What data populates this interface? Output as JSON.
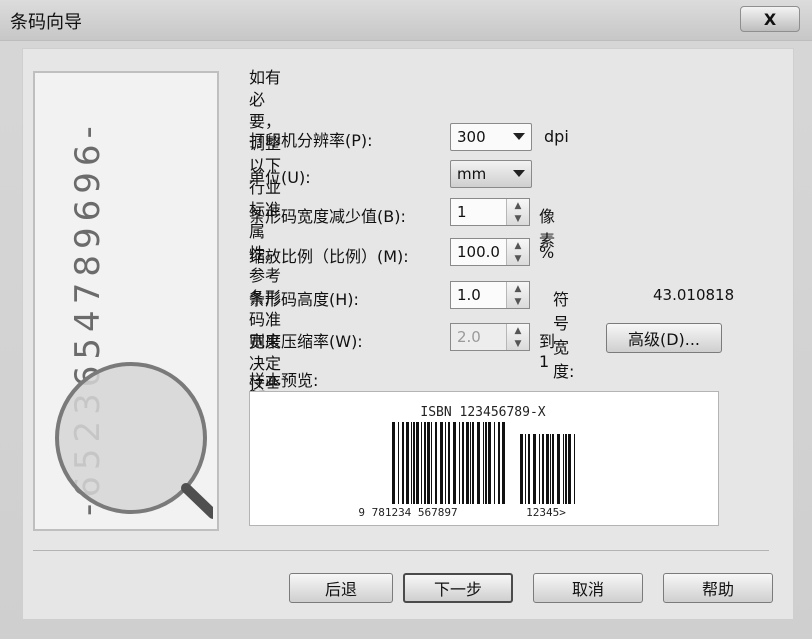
{
  "window": {
    "title": "条码向导",
    "close_label": "X"
  },
  "left_preview": {
    "digits": "-6523654789696-"
  },
  "intro": {
    "line1": "如有必要，调整以下行业标准属性。",
    "line2": "参考条形码准则来决定这些值。"
  },
  "fields": {
    "printer_resolution": {
      "label": "打印机分辨率(P):",
      "value": "300",
      "unit": "dpi"
    },
    "unit": {
      "label": "单位(U):",
      "value": "mm"
    },
    "bar_width_reduction": {
      "label": "条形码宽度减少值(B):",
      "value": "1",
      "unit": "像素"
    },
    "scale": {
      "label": "缩放比例（比例）(M):",
      "value": "100.0",
      "unit": "%"
    },
    "barcode_height": {
      "label": "条形码高度(H):",
      "value": "1.0",
      "symbol_width_label": "符号宽度:",
      "symbol_width_value": "43.010818"
    },
    "width_compression": {
      "label": "宽度压缩率(W):",
      "value": "2.0",
      "to_label": "到 1"
    }
  },
  "buttons": {
    "advanced": "高级(D)...",
    "back": "后退",
    "next": "下一步",
    "cancel": "取消",
    "help": "帮助"
  },
  "sample": {
    "label": "样本预览:",
    "isbn": "ISBN  123456789-X",
    "main_digits": "9  781234  567897",
    "addon_digits": "12345>"
  }
}
